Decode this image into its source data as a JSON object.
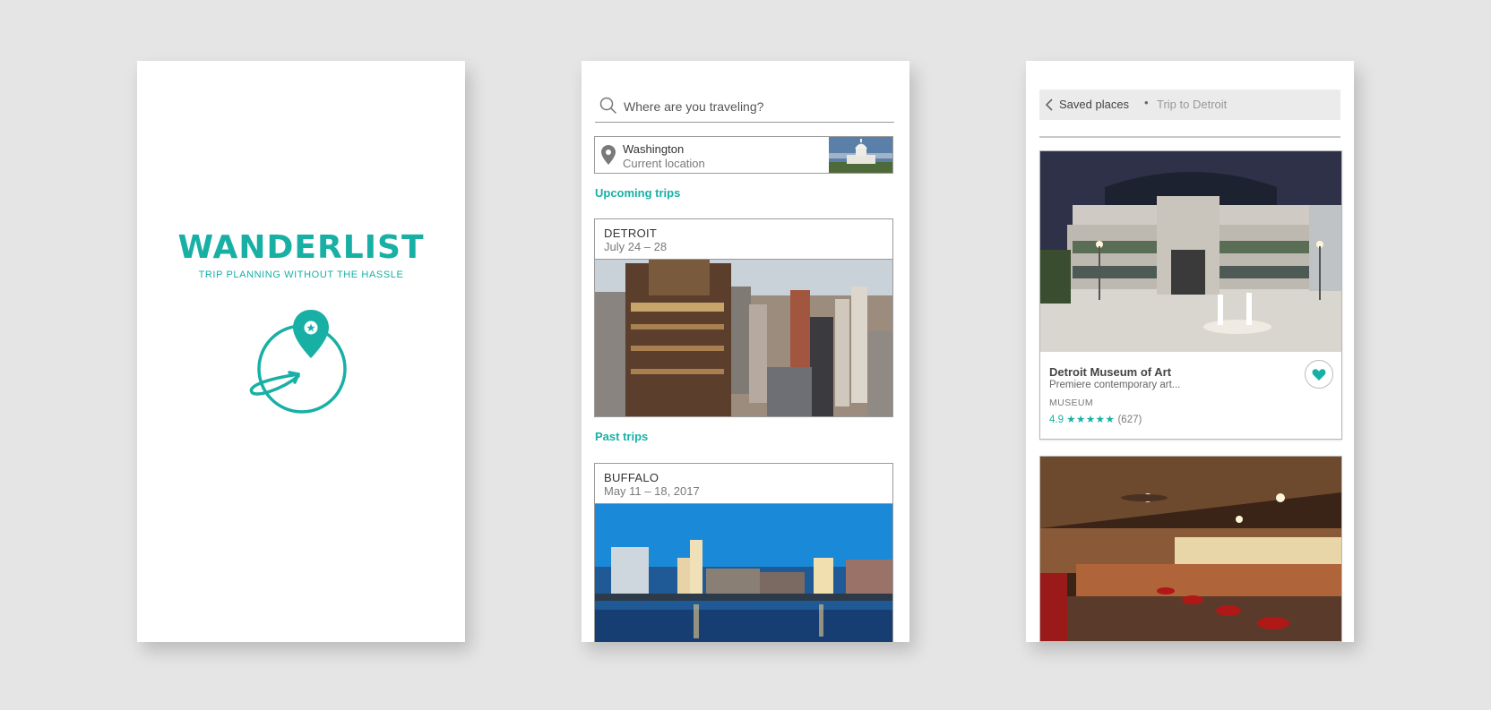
{
  "colors": {
    "accent": "#18b0a5",
    "background": "#e5e5e5",
    "card": "#ffffff"
  },
  "splash": {
    "title": "WANDERLIST",
    "tagline": "TRIP PLANNING WITHOUT THE HASSLE",
    "logo_icon": "globe-pin-icon"
  },
  "trips": {
    "search": {
      "placeholder": "Where are you traveling?",
      "value": ""
    },
    "location": {
      "name": "Washington",
      "subtitle": "Current location"
    },
    "upcoming": {
      "heading": "Upcoming trips",
      "items": [
        {
          "name": "DETROIT",
          "dates": "July 24 – 28"
        }
      ]
    },
    "past": {
      "heading": "Past trips",
      "items": [
        {
          "name": "BUFFALO",
          "dates": "May 11 – 18, 2017"
        }
      ]
    }
  },
  "saved": {
    "breadcrumb": {
      "current": "Saved places",
      "separator": "•",
      "parent": "Trip to Detroit"
    },
    "places": [
      {
        "name": "Detroit Museum of Art",
        "description": "Premiere contemporary art...",
        "category": "MUSEUM",
        "rating": "4.9",
        "stars": "★★★★★",
        "reviews": "(627)",
        "favorited": true
      }
    ]
  }
}
